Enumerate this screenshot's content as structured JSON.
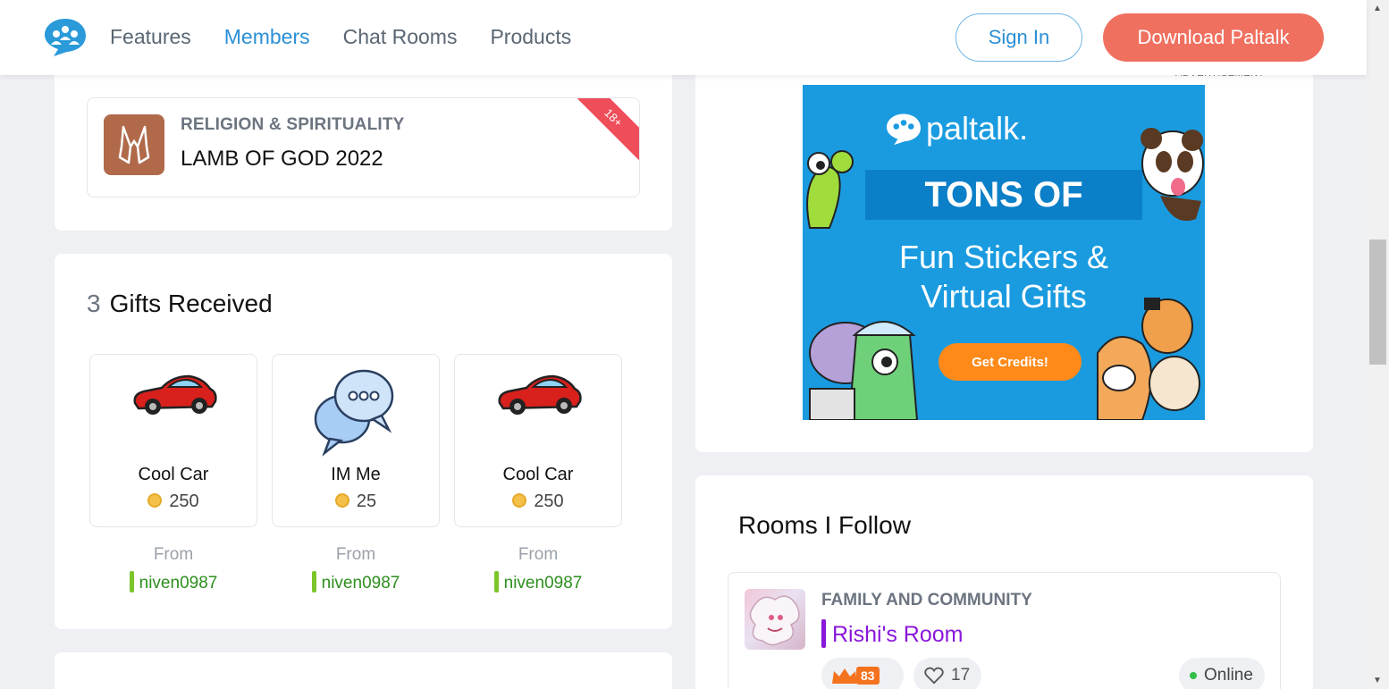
{
  "header": {
    "nav": [
      "Features",
      "Members",
      "Chat Rooms",
      "Products"
    ],
    "active_nav": "Members",
    "sign_in": "Sign In",
    "download": "Download Paltalk"
  },
  "top_room": {
    "category": "RELIGION & SPIRITUALITY",
    "name": "LAMB OF GOD 2022",
    "badge": "18+"
  },
  "gifts": {
    "count": "3",
    "title": "Gifts Received",
    "items": [
      {
        "name": "Cool Car",
        "price": "250",
        "from_label": "From",
        "sender": "niven0987",
        "icon": "car-icon"
      },
      {
        "name": "IM Me",
        "price": "25",
        "from_label": "From",
        "sender": "niven0987",
        "icon": "chat-bubbles-icon"
      },
      {
        "name": "Cool Car",
        "price": "250",
        "from_label": "From",
        "sender": "niven0987",
        "icon": "car-icon"
      }
    ]
  },
  "ad": {
    "label": "ADVERTISEMENT",
    "logo": "paltalk.",
    "line1": "TONS OF",
    "line2": "Fun Stickers &",
    "line3": "Virtual Gifts",
    "cta": "Get Credits!"
  },
  "follow": {
    "title": "Rooms I Follow",
    "room": {
      "category": "FAMILY AND COMMUNITY",
      "name": "Rishi's Room",
      "rank": "83",
      "likes": "17",
      "status": "Online"
    }
  },
  "colors": {
    "accent": "#2a8fd6",
    "cta": "#f07060",
    "online": "#33c04a",
    "room_name": "#8a16d9",
    "sender": "#2d8f1e"
  }
}
